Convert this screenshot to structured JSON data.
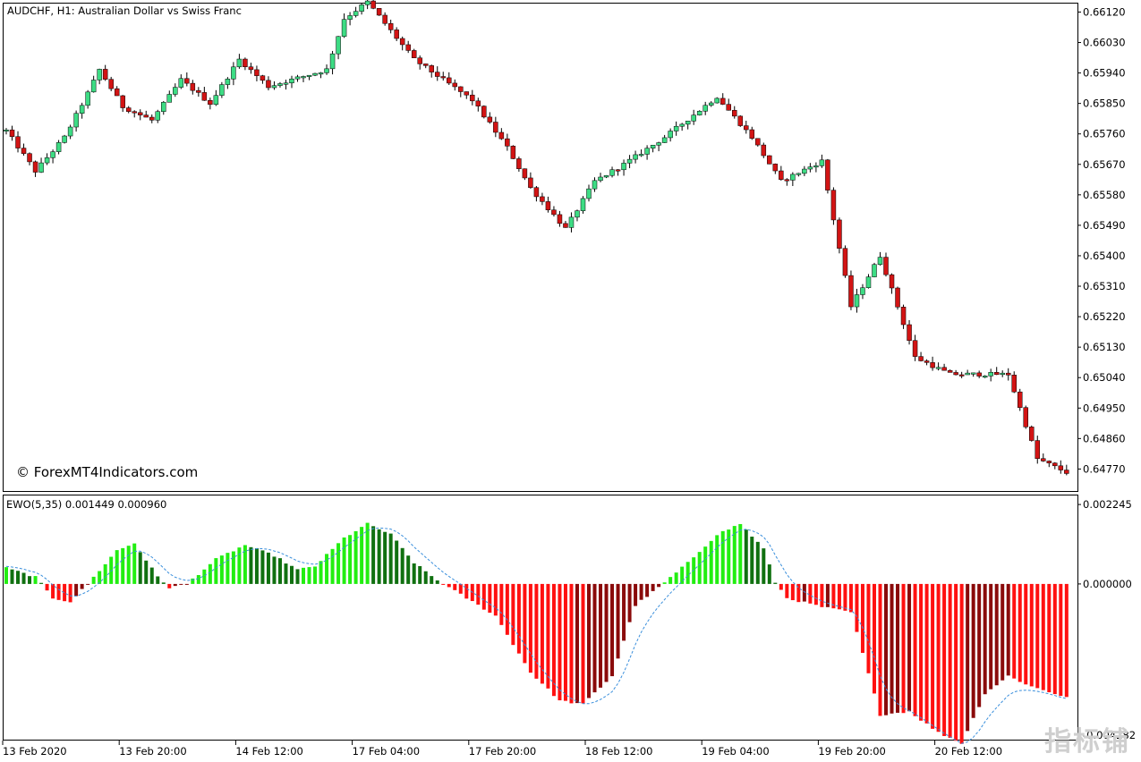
{
  "chart_data": [
    {
      "type": "candlestick",
      "symbol": "AUDCHF",
      "timeframe": "H1",
      "title": "AUDCHF, H1:  Australian Dollar vs Swiss Franc",
      "watermark": "© ForexMT4Indicators.com",
      "ylim": [
        0.64705,
        0.66145
      ],
      "y_ticks": [
        "0.66120",
        "0.66030",
        "0.65940",
        "0.65850",
        "0.65760",
        "0.65670",
        "0.65580",
        "0.65490",
        "0.65400",
        "0.65310",
        "0.65220",
        "0.65130",
        "0.65040",
        "0.64950",
        "0.64860",
        "0.64770"
      ],
      "x_ticks": [
        "13 Feb 2020",
        "13 Feb 20:00",
        "14 Feb 12:00",
        "17 Feb 04:00",
        "17 Feb 20:00",
        "18 Feb 12:00",
        "19 Feb 04:00",
        "19 Feb 20:00",
        "20 Feb 12:00"
      ],
      "colors": {
        "bull": "#3ddc84",
        "bear": "#d21414",
        "wick": "#000000"
      },
      "anchors": [
        [
          0,
          0.6577
        ],
        [
          5,
          0.6565
        ],
        [
          10,
          0.6575
        ],
        [
          14,
          0.6588
        ],
        [
          16,
          0.6595
        ],
        [
          20,
          0.6584
        ],
        [
          25,
          0.658
        ],
        [
          30,
          0.6592
        ],
        [
          35,
          0.6585
        ],
        [
          40,
          0.6598
        ],
        [
          45,
          0.659
        ],
        [
          55,
          0.6595
        ],
        [
          58,
          0.661
        ],
        [
          62,
          0.6615
        ],
        [
          70,
          0.6598
        ],
        [
          80,
          0.6586
        ],
        [
          86,
          0.6572
        ],
        [
          90,
          0.656
        ],
        [
          96,
          0.6548
        ],
        [
          101,
          0.6562
        ],
        [
          106,
          0.6567
        ],
        [
          113,
          0.6575
        ],
        [
          122,
          0.6587
        ],
        [
          128,
          0.6575
        ],
        [
          133,
          0.6562
        ],
        [
          140,
          0.6568
        ],
        [
          145,
          0.6525
        ],
        [
          150,
          0.654
        ],
        [
          156,
          0.651
        ],
        [
          162,
          0.6505
        ],
        [
          172,
          0.6505
        ],
        [
          177,
          0.648
        ],
        [
          182,
          0.6476
        ]
      ]
    },
    {
      "type": "bar",
      "indicator": "EWO",
      "label": "EWO(5,35) 0.001449 0.000960",
      "ylim": [
        -0.0044,
        0.0025
      ],
      "y_ticks": [
        "0.002245",
        "0.000000"
      ],
      "y_ticks_partial": [
        "-0.004282"
      ],
      "colors": {
        "rising_pos": "#22ee11",
        "falling_pos": "#107010",
        "falling_neg": "#ff1010",
        "rising_neg": "#8a0a0a",
        "signal": "#3a8fdc"
      },
      "anchors": [
        [
          0,
          0.00045
        ],
        [
          5,
          0.0002
        ],
        [
          8,
          -0.0004
        ],
        [
          11,
          -0.0005
        ],
        [
          14,
          0.0
        ],
        [
          19,
          0.00095
        ],
        [
          22,
          0.00115
        ],
        [
          26,
          0.0002
        ],
        [
          28,
          -0.0001
        ],
        [
          31,
          0.0
        ],
        [
          36,
          0.0007
        ],
        [
          41,
          0.0011
        ],
        [
          46,
          0.0008
        ],
        [
          50,
          0.0004
        ],
        [
          53,
          0.0005
        ],
        [
          58,
          0.0013
        ],
        [
          62,
          0.0017
        ],
        [
          66,
          0.0014
        ],
        [
          70,
          0.0006
        ],
        [
          74,
          0.0001
        ],
        [
          78,
          -0.0003
        ],
        [
          84,
          -0.0009
        ],
        [
          90,
          -0.0025
        ],
        [
          95,
          -0.0033
        ],
        [
          99,
          -0.0034
        ],
        [
          104,
          -0.0026
        ],
        [
          108,
          -0.0006
        ],
        [
          112,
          -0.0001
        ],
        [
          117,
          0.0006
        ],
        [
          122,
          0.0014
        ],
        [
          126,
          0.0017
        ],
        [
          130,
          0.001
        ],
        [
          132,
          5e-05
        ],
        [
          134,
          -0.0004
        ],
        [
          140,
          -0.00065
        ],
        [
          145,
          -0.0008
        ],
        [
          150,
          -0.0037
        ],
        [
          155,
          -0.0036
        ],
        [
          160,
          -0.0042
        ],
        [
          164,
          -0.0045
        ],
        [
          168,
          -0.0031
        ],
        [
          172,
          -0.0026
        ],
        [
          176,
          -0.0029
        ],
        [
          182,
          -0.0032
        ]
      ]
    }
  ],
  "watermark_logo": "指标铺"
}
